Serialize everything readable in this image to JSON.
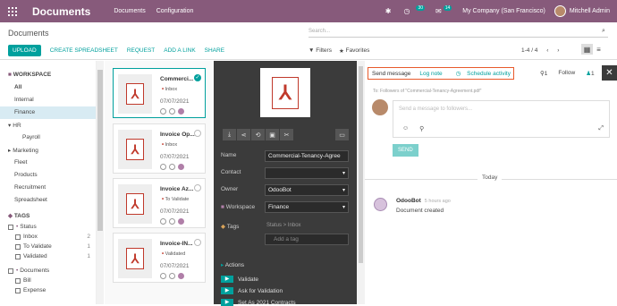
{
  "topbar": {
    "app_title": "Documents",
    "menu": [
      "Documents",
      "Configuration"
    ],
    "chat_count": "30",
    "activity_count": "14",
    "company": "My Company (San Francisco)",
    "user": "Mitchell Admin"
  },
  "control": {
    "breadcrumb": "Documents",
    "search_placeholder": "Search...",
    "buttons": {
      "upload": "UPLOAD",
      "spreadsheet": "CREATE SPREADSHEET",
      "request": "REQUEST",
      "link": "ADD A LINK",
      "share": "SHARE"
    },
    "filters": "Filters",
    "favorites": "Favorites",
    "pager": "1-4 / 4"
  },
  "sidebar": {
    "workspace_title": "WORKSPACE",
    "workspaces": [
      "All",
      "Internal",
      "Finance",
      "HR",
      "Payroll",
      "Marketing",
      "Fleet",
      "Products",
      "Recruitment",
      "Spreadsheet"
    ],
    "tags_title": "TAGS",
    "status_label": "Status",
    "status_items": [
      {
        "label": "Inbox",
        "count": "2"
      },
      {
        "label": "To Validate",
        "count": "1"
      },
      {
        "label": "Validated",
        "count": "1"
      }
    ],
    "documents_label": "Documents",
    "doc_items": [
      "Bill",
      "Expense"
    ]
  },
  "cards": [
    {
      "title": "Commerci...",
      "tag": "Inbox",
      "date": "07/07/2021"
    },
    {
      "title": "Invoice Op...",
      "tag": "Inbox",
      "date": "07/07/2021"
    },
    {
      "title": "Invoice Az...",
      "tag": "To Validate",
      "date": "07/07/2021"
    },
    {
      "title": "Invoice-IN...",
      "tag": "Validated",
      "date": "07/07/2021"
    }
  ],
  "inspector": {
    "name_label": "Name",
    "name_value": "Commercial-Tenancy-Agree",
    "contact_label": "Contact",
    "owner_label": "Owner",
    "owner_value": "OdooBot",
    "workspace_label": "Workspace",
    "workspace_value": "Finance",
    "tags_label": "Tags",
    "tags_value": "Status > Inbox",
    "add_tag": "Add a tag",
    "actions_label": "Actions",
    "action_items": [
      "Validate",
      "Ask for Validation",
      "Set As 2021 Contracts"
    ]
  },
  "chatter": {
    "tab_send": "Send message",
    "tab_log": "Log note",
    "tab_schedule": "Schedule activity",
    "attach_count": "1",
    "follow": "Follow",
    "followers_count": "1",
    "followers_note": "To: Followers of \"Commercial-Tenancy-Agreement.pdf\"",
    "composer_placeholder": "Send a message to followers...",
    "send_button": "SEND",
    "today": "Today",
    "msg_author": "OdooBot",
    "msg_time": "5 hours ago",
    "msg_body": "Document created"
  },
  "colors": {
    "brand": "#875a7b",
    "accent": "#00a09d",
    "highlight": "#e85a2b"
  }
}
